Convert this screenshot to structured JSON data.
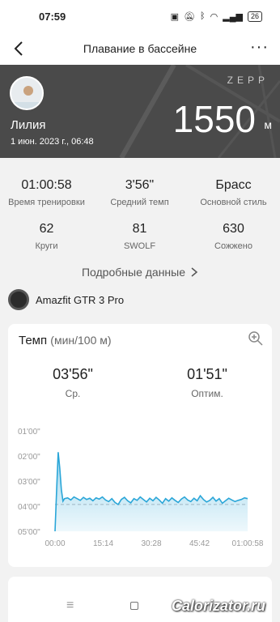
{
  "status_bar": {
    "time": "07:59",
    "battery": "26"
  },
  "nav": {
    "title": "Плавание в бассейне",
    "more": "···"
  },
  "hero": {
    "brand": "ZEPP",
    "user_name": "Лилия",
    "datetime": "1 июн. 2023 г., 06:48",
    "distance": "1550",
    "distance_unit": "м"
  },
  "stats": [
    {
      "value": "01:00:58",
      "label": "Время тренировки"
    },
    {
      "value": "3'56\"",
      "label": "Средний темп"
    },
    {
      "value": "Брасс",
      "label": "Основной стиль"
    },
    {
      "value": "62",
      "label": "Круги"
    },
    {
      "value": "81",
      "label": "SWOLF"
    },
    {
      "value": "630",
      "label": "Сожжено"
    }
  ],
  "details_link": "Подробные данные",
  "device": {
    "name": "Amazfit GTR 3 Pro"
  },
  "pace_card": {
    "title": "Темп",
    "unit": "(мин/100 м)",
    "avg_value": "03'56\"",
    "avg_label": "Ср.",
    "best_value": "01'51\"",
    "best_label": "Оптим."
  },
  "chart_data": {
    "type": "area",
    "xlabel": "",
    "ylabel": "",
    "x_ticks": [
      "00:00",
      "15:14",
      "30:28",
      "45:42",
      "01:00:58"
    ],
    "y_ticks": [
      "01'00\"",
      "02'00\"",
      "03'00\"",
      "04'00\"",
      "05'00\""
    ],
    "ylim_seconds": [
      60,
      300
    ],
    "y_inverted": true,
    "average_line_seconds": 236,
    "x_minutes": [
      0,
      0.5,
      1,
      1.5,
      2,
      2.5,
      3,
      4,
      5,
      6,
      7,
      8,
      9,
      10,
      11,
      12,
      13,
      14,
      15,
      16,
      17,
      18,
      19,
      20,
      21,
      22,
      23,
      24,
      25,
      26,
      27,
      28,
      29,
      30,
      31,
      32,
      33,
      34,
      35,
      36,
      37,
      38,
      39,
      40,
      41,
      42,
      43,
      44,
      45,
      46,
      47,
      48,
      49,
      50,
      51,
      52,
      53,
      54,
      55,
      56,
      57,
      58,
      59,
      60,
      61
    ],
    "pace_seconds": [
      300,
      200,
      111,
      150,
      200,
      228,
      222,
      220,
      225,
      218,
      222,
      226,
      219,
      224,
      221,
      227,
      220,
      223,
      218,
      225,
      229,
      222,
      231,
      236,
      224,
      219,
      227,
      232,
      222,
      226,
      218,
      224,
      230,
      221,
      227,
      219,
      225,
      233,
      222,
      228,
      220,
      226,
      231,
      223,
      218,
      225,
      229,
      221,
      227,
      215,
      224,
      230,
      226,
      219,
      228,
      222,
      233,
      227,
      221,
      225,
      229,
      226,
      224,
      220,
      222
    ],
    "color": "#2aa6d8"
  },
  "bottom": {
    "menu_icon": "≡"
  },
  "watermark": "Calorizator.ru"
}
